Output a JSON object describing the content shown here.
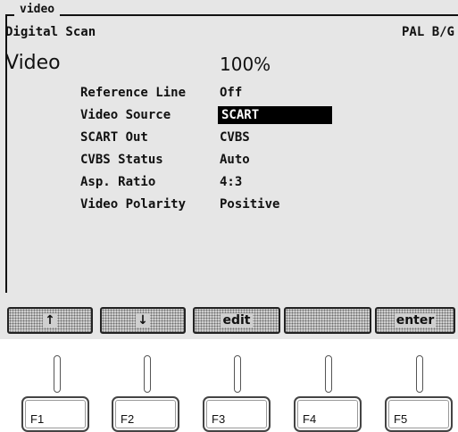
{
  "window": {
    "title": "video"
  },
  "header": {
    "mode": "Digital Scan",
    "standard": "PAL B/G"
  },
  "main": {
    "heading": "Video",
    "level": "100%",
    "settings": [
      {
        "label": "Reference Line",
        "value": "Off",
        "selected": false
      },
      {
        "label": "Video Source",
        "value": "SCART",
        "selected": true
      },
      {
        "label": "SCART Out",
        "value": "CVBS",
        "selected": false
      },
      {
        "label": "CVBS Status",
        "value": "Auto",
        "selected": false
      },
      {
        "label": "Asp. Ratio",
        "value": "4:3",
        "selected": false
      },
      {
        "label": "Video Polarity",
        "value": "Positive",
        "selected": false
      }
    ]
  },
  "softkeys": [
    {
      "label": "↑",
      "icon": "arrow-up-icon"
    },
    {
      "label": "↓",
      "icon": "arrow-down-icon"
    },
    {
      "label": "edit"
    },
    {
      "label": ""
    },
    {
      "label": "enter"
    }
  ],
  "function_keys": [
    "F1",
    "F2",
    "F3",
    "F4",
    "F5"
  ],
  "colors": {
    "screen_bg": "#e6e6e6",
    "text": "#111111",
    "selection_bg": "#000000"
  }
}
